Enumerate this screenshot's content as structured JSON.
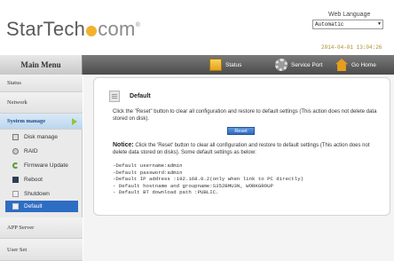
{
  "header": {
    "logo_main": "StarTech",
    "logo_tld": "com",
    "logo_reg": "®",
    "language_label": "Web Language",
    "language_value": "Automatic",
    "datetime": "2014-04-01 13:04:26"
  },
  "sidebar": {
    "title": "Main Menu",
    "status": "Status",
    "network": "Network",
    "system_manage": "System manage",
    "sub": {
      "disk": "Disk manage",
      "raid": "RAID",
      "firmware": "Firmware Update",
      "reboot": "Reboot",
      "shutdown": "Shutdown",
      "default": "Default"
    },
    "app_server": "APP Server",
    "user_set": "User Set"
  },
  "nav": {
    "status": "Status",
    "service_port": "Service Port",
    "go_home": "Go Home"
  },
  "panel": {
    "title": "Default",
    "description": "Click the \"Reset\" button to clear all configuration and restore to default settings (This action does not delete data stored on disk).",
    "reset_button": "Reset",
    "notice_label": "Notice:",
    "notice_text": "Click the 'Reset' button to clear all configuration and restore to default settings (This action does not delete data stored on disks). Some default settings as below:",
    "defaults": [
      "-Default username:admin",
      "-Default password:admin",
      "-Default IP address :192.168.0.2(only when link to PC directly)",
      "- Default hostname and groupname:S352BMU3N, WORKGROUP",
      "- Default BT download path :PUBLIC."
    ]
  },
  "colors": {
    "accent_blue": "#2e6dc4",
    "logo_orange": "#f2b22b",
    "topbar_dark": "#4a4a4a"
  }
}
